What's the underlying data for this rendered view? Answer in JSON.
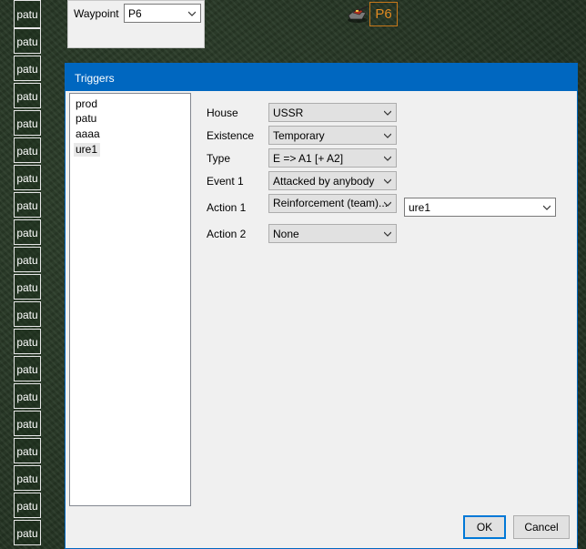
{
  "map": {
    "cell_label": "patu",
    "cell_count": 20,
    "waypoint_marker": "P6"
  },
  "waypoint_panel": {
    "label": "Waypoint",
    "value": "P6"
  },
  "dialog": {
    "title": "Triggers",
    "triggers": [
      "prod",
      "patu",
      "aaaa",
      "ure1"
    ],
    "selected_trigger": "ure1",
    "fields": {
      "house": {
        "label": "House",
        "value": "USSR"
      },
      "existence": {
        "label": "Existence",
        "value": "Temporary"
      },
      "type": {
        "label": "Type",
        "value": "E => A1 [+ A2]"
      },
      "event1": {
        "label": "Event 1",
        "value": "Attacked by anybody"
      },
      "action1": {
        "label": "Action 1",
        "value": "Reinforcement (team)...",
        "param": "ure1"
      },
      "action2": {
        "label": "Action 2",
        "value": "None"
      }
    },
    "ok_label": "OK",
    "cancel_label": "Cancel"
  },
  "colors": {
    "title_bar": "#0067c0",
    "marker": "#e08a22",
    "dialog_bg": "#f0f0f0"
  }
}
